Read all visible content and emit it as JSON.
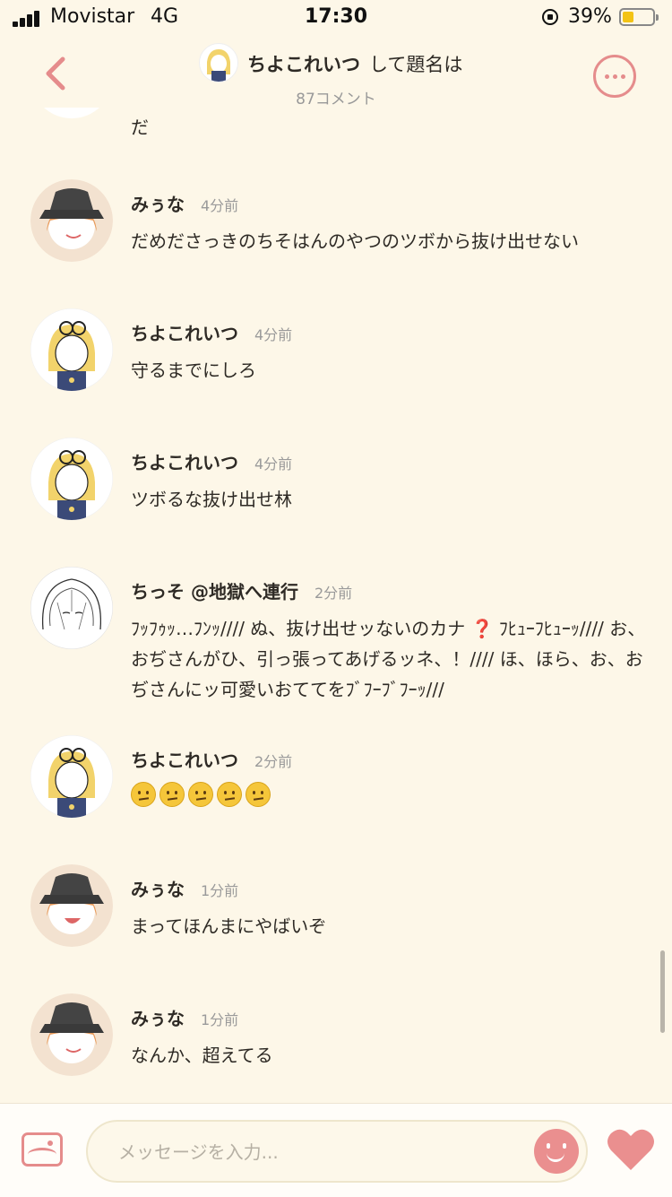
{
  "status_bar": {
    "carrier": "Movistar",
    "network": "4G",
    "time": "17:30",
    "battery_percent": "39%"
  },
  "header": {
    "user_name": "ちよこれいつ",
    "title_suffix": "して題名は",
    "comment_count": "87コメント"
  },
  "partial_message": {
    "text": "だ"
  },
  "messages": [
    {
      "author": "みぅな",
      "time": "4分前",
      "text": "だめださっきのちそはんのやつのツボから抜け出せない",
      "avatar": "hat-avatar"
    },
    {
      "author": "ちよこれいつ",
      "time": "4分前",
      "text": "守るまでにしろ",
      "avatar": "blonde-avatar"
    },
    {
      "author": "ちよこれいつ",
      "time": "4分前",
      "text": "ツボるな抜け出せ林",
      "avatar": "blonde-avatar"
    },
    {
      "author": "ちっそ @地獄へ連行",
      "time": "2分前",
      "text": "ﾌｯﾌｩｯ…ﾌﾝｯ//// ぬ、抜け出せッないのカナ ❓ ﾌﾋｭｰﾌﾋｭｰｯ//// お、おぢさんがひ、引っ張ってあげるッネ、！//// ほ、ほら、お、おぢさんにッ可愛いおててをﾌﾞﾌｰﾌﾞﾌｰｯ///",
      "avatar": "sketch-avatar"
    },
    {
      "author": "ちよこれいつ",
      "time": "2分前",
      "emojis": [
        "😕",
        "😕",
        "😕",
        "😕",
        "😕"
      ],
      "avatar": "blonde-avatar"
    },
    {
      "author": "みぅな",
      "time": "1分前",
      "text": "まってほんまにやばいぞ",
      "avatar": "hat-avatar"
    },
    {
      "author": "みぅな",
      "time": "1分前",
      "text": "なんか、超えてる",
      "avatar": "hat-avatar"
    }
  ],
  "input": {
    "placeholder": "メッセージを入力..."
  },
  "colors": {
    "accent": "#e58c8c",
    "background": "#fdf7e8",
    "heart": "#ea8f8f"
  }
}
